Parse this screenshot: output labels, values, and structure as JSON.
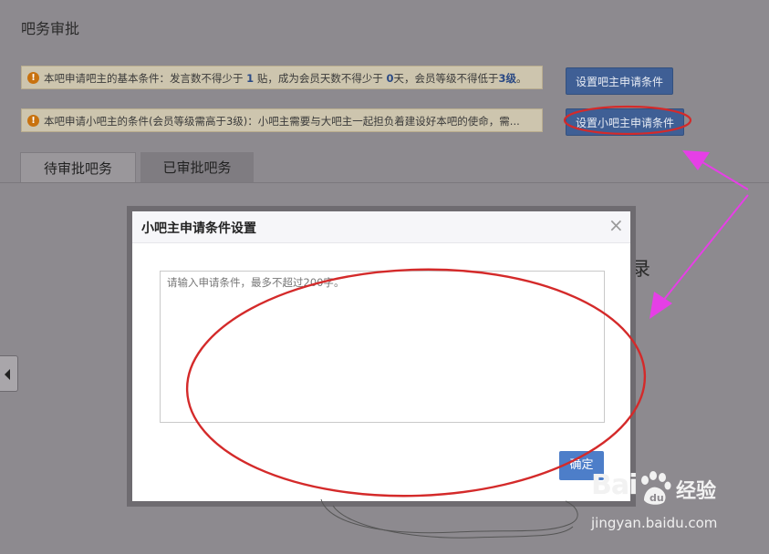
{
  "page": {
    "title": "吧务审批"
  },
  "notices": [
    {
      "prefix": "本吧申请吧主的基本条件：发言数不得少于 ",
      "n1": "1",
      "mid1": " 贴，成为会员天数不得少于 ",
      "n2": "0",
      "mid2": "天，会员等级不得低于",
      "n3": "3级",
      "suffix": "。"
    },
    {
      "text": "本吧申请小吧主的条件(会员等级需高于3级)：小吧主需要与大吧主一起担负着建设好本吧的使命，需..."
    }
  ],
  "buttons": {
    "set_owner_conditions": "设置吧主申请条件",
    "set_small_owner_conditions": "设置小吧主申请条件"
  },
  "tabs": [
    {
      "label": "待审批吧务",
      "active": true
    },
    {
      "label": "已审批吧务",
      "active": false
    }
  ],
  "background": {
    "partial_text": "录"
  },
  "modal": {
    "title": "小吧主申请条件设置",
    "close": "×",
    "textarea_placeholder": "请输入申请条件，最多不超过200字。",
    "textarea_value": "",
    "ok_label": "确定"
  },
  "watermark": {
    "brand": "Bai",
    "brand_cn": "经验",
    "url": "jingyan.baidu.com"
  },
  "colors": {
    "annotation_circle": "#d42a2a",
    "annotation_arrow": "#e63fe6",
    "primary_button": "#3f5f95",
    "ok_button": "#4d7ec9",
    "warning_icon": "#c8720f"
  }
}
